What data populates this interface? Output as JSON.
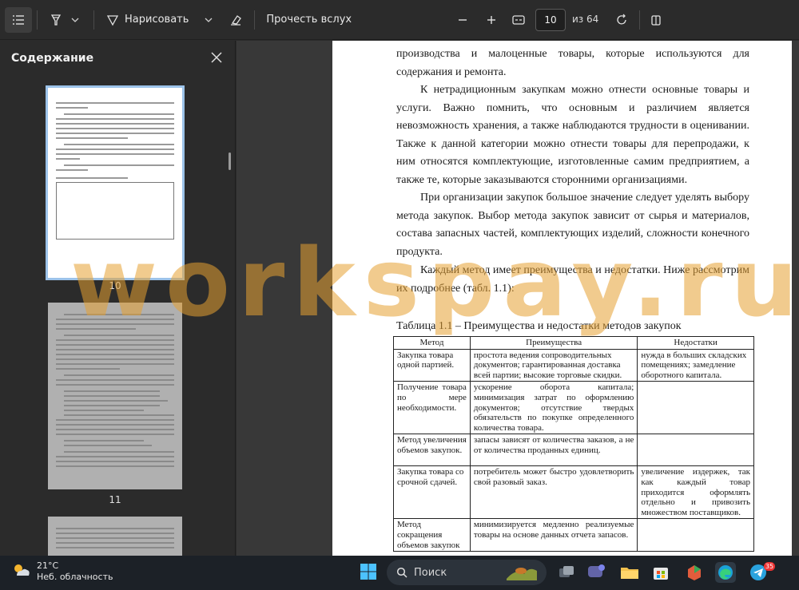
{
  "toolbar": {
    "draw_label": "Нарисовать",
    "read_aloud_label": "Прочесть вслух",
    "current_page": "10",
    "page_of": "из 64"
  },
  "sidebar": {
    "title": "Содержание",
    "thumbs": [
      {
        "label": "10"
      },
      {
        "label": "11"
      }
    ]
  },
  "document": {
    "paragraphs": [
      "производства и малоценные товары, которые используются для содержания и ремонта.",
      "К нетрадиционным закупкам можно отнести основные товары и услуги. Важно помнить, что основным и различием является невозможность хранения, а также наблюдаются трудности в оценивании. Также к данной категории можно отнести товары для перепродажи, к ним относятся комплектующие, изготовленные самим предприятием, а также те, которые заказываются сторонними организациями.",
      "При организации закупок большое значение следует уделять выбору метода закупок. Выбор метода закупок зависит от сырья и материалов, состава запасных частей, комплектующих изделий, сложности конечного продукта.",
      "Каждый метод имеет преимущества и недостатки. Ниже рассмотрим их подробнее (табл. 1.1):"
    ],
    "table_caption": "Таблица 1.1 – Преимущества и недостатки методов закупок",
    "table": {
      "headers": [
        "Метод",
        "Преимущества",
        "Недостатки"
      ],
      "rows": [
        [
          "Закупка товара одной партией.",
          "простота ведения сопроводительных документов; гарантированная доставка всей партии; высокие торговые скидки.",
          "нужда в больших складских помещениях; замедление оборотного капитала."
        ],
        [
          "Получение товара по мере необходимости.",
          "ускорение оборота капитала; минимизация затрат по оформлению документов; отсутствие твердых обязательств по покупке определенного количества товара.",
          ""
        ],
        [
          "Метод увеличения объемов закупок.",
          "запасы зависят от количества заказов, а не от количества проданных единиц.",
          ""
        ],
        [
          "Закупка товара со срочной сдачей.",
          "потребитель может быстро удовлетворить свой разовый заказ.",
          "увеличение издержек, так как каждый товар приходится оформлять отдельно и привозить множеством поставщиков."
        ],
        [
          "Метод сокращения объемов закупок",
          "минимизируется медленно реализуемые товары на основе данных отчета запасов.",
          ""
        ]
      ]
    }
  },
  "watermark": "workspay.ru",
  "taskbar": {
    "temperature": "21°C",
    "weather_desc": "Неб. облачность",
    "search_label": "Поиск",
    "telegram_badge": "35"
  },
  "colors": {
    "accent": "#9cc3ea",
    "watermark": "#e6a032",
    "toolbar_bg": "#2b2b2b",
    "taskbar_bg": "#1c2127"
  }
}
